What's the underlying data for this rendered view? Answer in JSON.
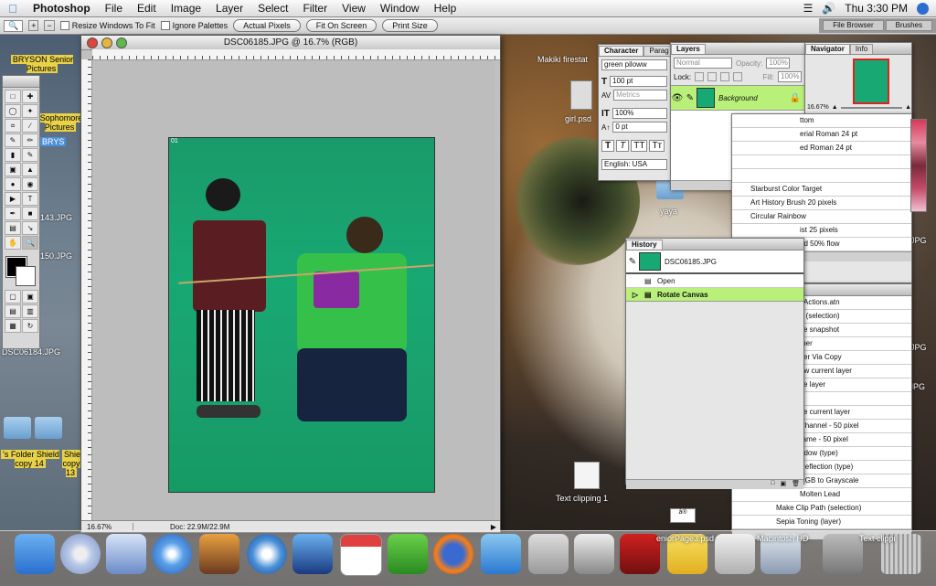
{
  "menubar": {
    "app_name": "Photoshop",
    "items": [
      "File",
      "Edit",
      "Image",
      "Layer",
      "Select",
      "Filter",
      "View",
      "Window",
      "Help"
    ],
    "clock": "Thu 3:30 PM"
  },
  "options_bar": {
    "resize_windows": "Resize Windows To Fit",
    "ignore_palettes": "Ignore Palettes",
    "actual_pixels": "Actual Pixels",
    "fit_on_screen": "Fit On Screen",
    "print_size": "Print Size",
    "file_browser": "File Browser",
    "brushes": "Brushes"
  },
  "desktop": {
    "left_labels": [
      "BRYSON Senior Pictures",
      "Sophomore Pictures",
      "143.JPG",
      "150.JPG",
      "DSC06184.JPG",
      "'s Folder Shield copy 14",
      "Shie copy 13"
    ],
    "bryson_short": "BRYS",
    "makiki": "Makiki firestat",
    "girl": "girl.psd",
    "yaya": "yaya",
    "text_clipping": "Text clipping 1",
    "jpg_labels": [
      "JPG",
      "JPG",
      ".JPG"
    ],
    "senior_page": "eniorPage3.psd",
    "macintosh": "Macintosh HD",
    "text_clip_right": "Text clippi",
    "small_box": "å®"
  },
  "document": {
    "title": "DSC06185.JPG @ 16.7% (RGB)",
    "zoom": "16.67%",
    "doc_size": "Doc: 22.9M/22.9M",
    "photo_tag": "01"
  },
  "character": {
    "tabs": [
      "Character",
      "Parag"
    ],
    "font": "green piloww",
    "size": "100 pt",
    "kerning": "Metrics",
    "scale": "100%",
    "baseline": "0 pt",
    "language": "English: USA"
  },
  "layers": {
    "tab": "Layers",
    "blend": "Normal",
    "opacity_label": "Opacity:",
    "opacity": "100%",
    "lock_label": "Lock:",
    "fill_label": "Fill:",
    "fill": "100%",
    "layer_name": "Background"
  },
  "navigator": {
    "tabs": [
      "Navigator",
      "Info"
    ],
    "zoom": "16.67%"
  },
  "brushes_list": [
    "ttom",
    "erial Roman 24 pt",
    "ed Roman 24 pt",
    "",
    "",
    "Starburst Color Target",
    "Art History Brush 20 pixels",
    "Circular Rainbow",
    "ist 25 pixels",
    "ed 50% flow"
  ],
  "history": {
    "tab": "History",
    "snapshot": "DSC06185.JPG",
    "states": [
      "Open",
      "Rotate Canvas"
    ]
  },
  "actions": {
    "items": [
      "t Actions.atn",
      "e (selection)",
      "ke snapshot",
      "ther",
      "yer Via Copy",
      "ow current layer",
      "ke layer",
      "",
      "ve current layer",
      "Channel - 50 pixel",
      "rame - 50 pixel",
      "adow (type)",
      "Reflection (type)",
      "RGB to Grayscale",
      "Molten Lead",
      "Make Clip Path (selection)",
      "Sepia Toning (layer)"
    ]
  },
  "colors": {
    "accent_green": "#b9f07a",
    "screen_green": "#18a873",
    "folder_label": "#e8d24a"
  }
}
